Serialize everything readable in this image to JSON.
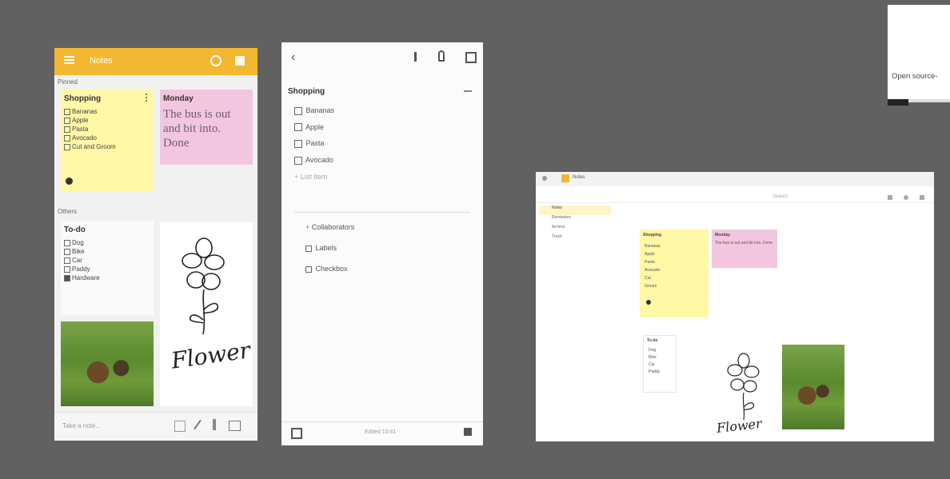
{
  "overlay_caption": "Open source-",
  "phone1": {
    "app_title": "Notes",
    "section_pinned": "Pinned",
    "section_others": "Others",
    "shopping_note": {
      "title": "Shopping",
      "items": [
        "Bananas",
        "Apple",
        "Pasta",
        "Avocado",
        "Cut and Groom"
      ]
    },
    "monday_note": {
      "title": "Monday",
      "body": "The bus is out and bit into. Done"
    },
    "todo_note": {
      "title": "To-do",
      "items": [
        "Dog",
        "Bike",
        "Car",
        "Paddy",
        "Hardware"
      ]
    },
    "drawing_caption": "Flower",
    "bottom_placeholder": "Take a note..."
  },
  "phone2": {
    "title": "Shopping",
    "items": [
      "Bananas",
      "Apple",
      "Pasta",
      "Avocado"
    ],
    "add_item": "List item",
    "actions": [
      "Collaborators",
      "Labels",
      "Checkbox"
    ],
    "footer_text": "Edited 10:41"
  },
  "desktop": {
    "tab_title": "Notes",
    "search_text": "Search",
    "sidebar": [
      "Notes",
      "Reminders",
      "Archive",
      "Trash"
    ],
    "shopping_title": "Shopping",
    "shopping_items": [
      "Bananas",
      "Apple",
      "Pasta",
      "Avocado",
      "Cut",
      "Groom"
    ],
    "monday_title": "Monday",
    "monday_body": "The bus is out and bit into. Done",
    "todo_title": "To-do",
    "todo_items": [
      "Dog",
      "Bike",
      "Car",
      "Paddy"
    ],
    "drawing_caption": "Flower"
  },
  "colors": {
    "background": "#616161",
    "accent_yellow": "#f3b731",
    "note_yellow": "#fff8a6",
    "note_pink": "#f3c6df"
  }
}
